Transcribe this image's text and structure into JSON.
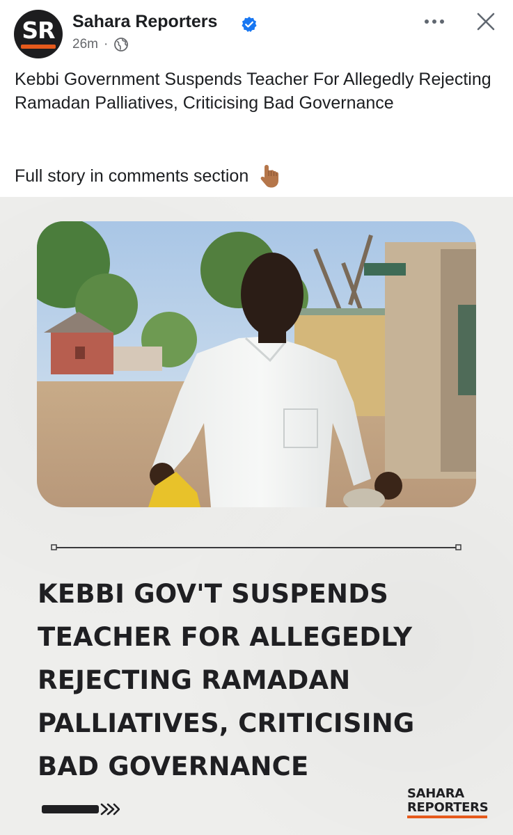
{
  "post": {
    "page_name": "Sahara Reporters",
    "avatar_text": "SR",
    "time": "26m",
    "separator": "·",
    "caption": "Kebbi Government Suspends Teacher For Allegedly Rejecting Ramadan Palliatives, Criticising Bad Governance",
    "cta": "Full story in comments section",
    "icons": {
      "verified": "verified-badge-icon",
      "audience": "globe-icon",
      "more": "more-options-icon",
      "close": "close-icon",
      "pointing": "pointing-down-emoji-icon"
    }
  },
  "card": {
    "headline_lines": [
      "KEBBI GOV'T SUSPENDS",
      "TEACHER FOR ALLEGEDLY",
      "REJECTING RAMADAN",
      "PALLIATIVES, CRITICISING",
      "BAD GOVERNANCE"
    ],
    "brand_line1": "SAHARA",
    "brand_line2": "REPORTERS",
    "colors": {
      "background": "#eeeeec",
      "headline": "#1f1f22",
      "brand_accent": "#e55a1c"
    }
  }
}
